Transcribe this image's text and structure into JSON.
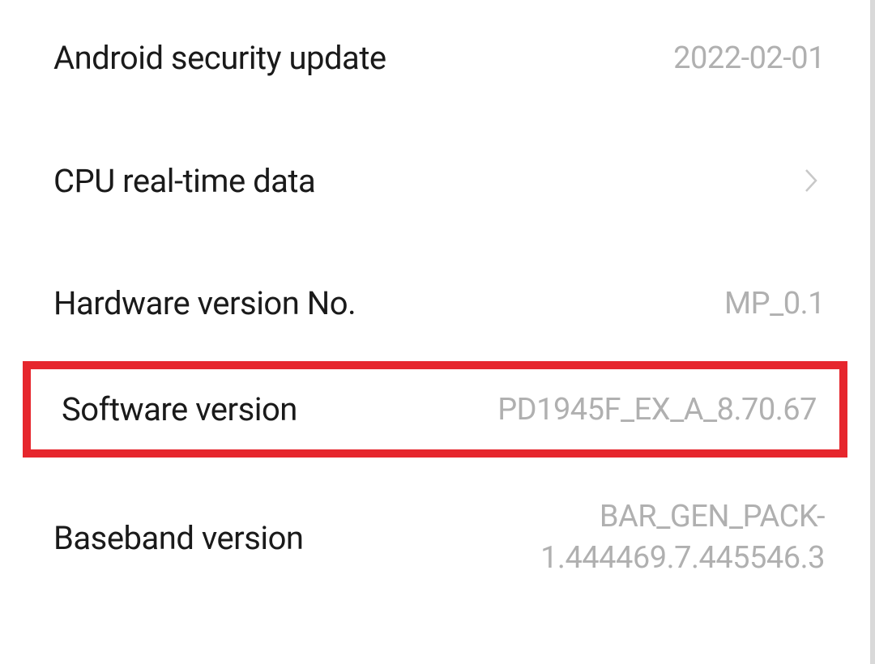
{
  "rows": {
    "security_update": {
      "label": "Android security update",
      "value": "2022-02-01"
    },
    "cpu_data": {
      "label": "CPU real-time data"
    },
    "hardware_version": {
      "label": "Hardware version No.",
      "value": "MP_0.1"
    },
    "software_version": {
      "label": "Software version",
      "value": "PD1945F_EX_A_8.70.67"
    },
    "baseband_version": {
      "label": "Baseband version",
      "value": "BAR_GEN_PACK-1.444469.7.445546.3"
    }
  }
}
